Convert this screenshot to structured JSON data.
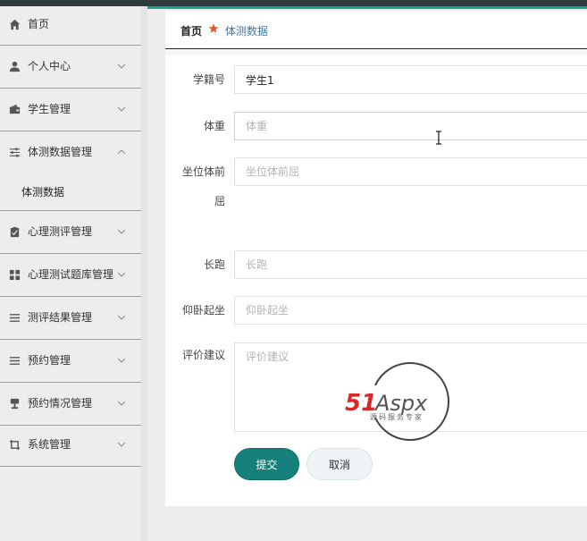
{
  "sidebar": {
    "items": [
      {
        "label": "首页",
        "icon": "home-icon"
      },
      {
        "label": "个人中心",
        "icon": "user-icon"
      },
      {
        "label": "学生管理",
        "icon": "wallet-icon"
      },
      {
        "label": "体测数据管理",
        "icon": "sliders-icon",
        "expanded": true,
        "sub": [
          {
            "label": "体测数据"
          }
        ]
      },
      {
        "label": "心理测评管理",
        "icon": "clipboard-icon"
      },
      {
        "label": "心理测试题库管理",
        "icon": "grid-icon"
      },
      {
        "label": "测评结果管理",
        "icon": "list-icon"
      },
      {
        "label": "预约管理",
        "icon": "list-icon"
      },
      {
        "label": "预约情况管理",
        "icon": "stamp-icon"
      },
      {
        "label": "系统管理",
        "icon": "crop-icon"
      }
    ]
  },
  "breadcrumb": {
    "home": "首页",
    "current": "体测数据"
  },
  "form": {
    "student_no": {
      "label": "学籍号",
      "value": "学生1"
    },
    "weight": {
      "label": "体重",
      "placeholder": "体重",
      "value": ""
    },
    "sit_reach": {
      "label_line1": "坐位体前",
      "label_line2": "屈",
      "placeholder": "坐位体前屈",
      "value": ""
    },
    "long_run": {
      "label": "长跑",
      "placeholder": "长跑",
      "value": ""
    },
    "situps": {
      "label": "仰卧起坐",
      "placeholder": "仰卧起坐",
      "value": ""
    },
    "advice": {
      "label": "评价建议",
      "placeholder": "评价建议",
      "value": ""
    }
  },
  "buttons": {
    "submit": "提交",
    "cancel": "取消"
  },
  "watermark": {
    "brand": "51Aspx",
    "tagline": "源码服务专家"
  },
  "colors": {
    "accent": "#16807a",
    "topbar": "#2f3b3c",
    "breadcrumb_link": "#3a77a5",
    "star": "#e4572e"
  }
}
